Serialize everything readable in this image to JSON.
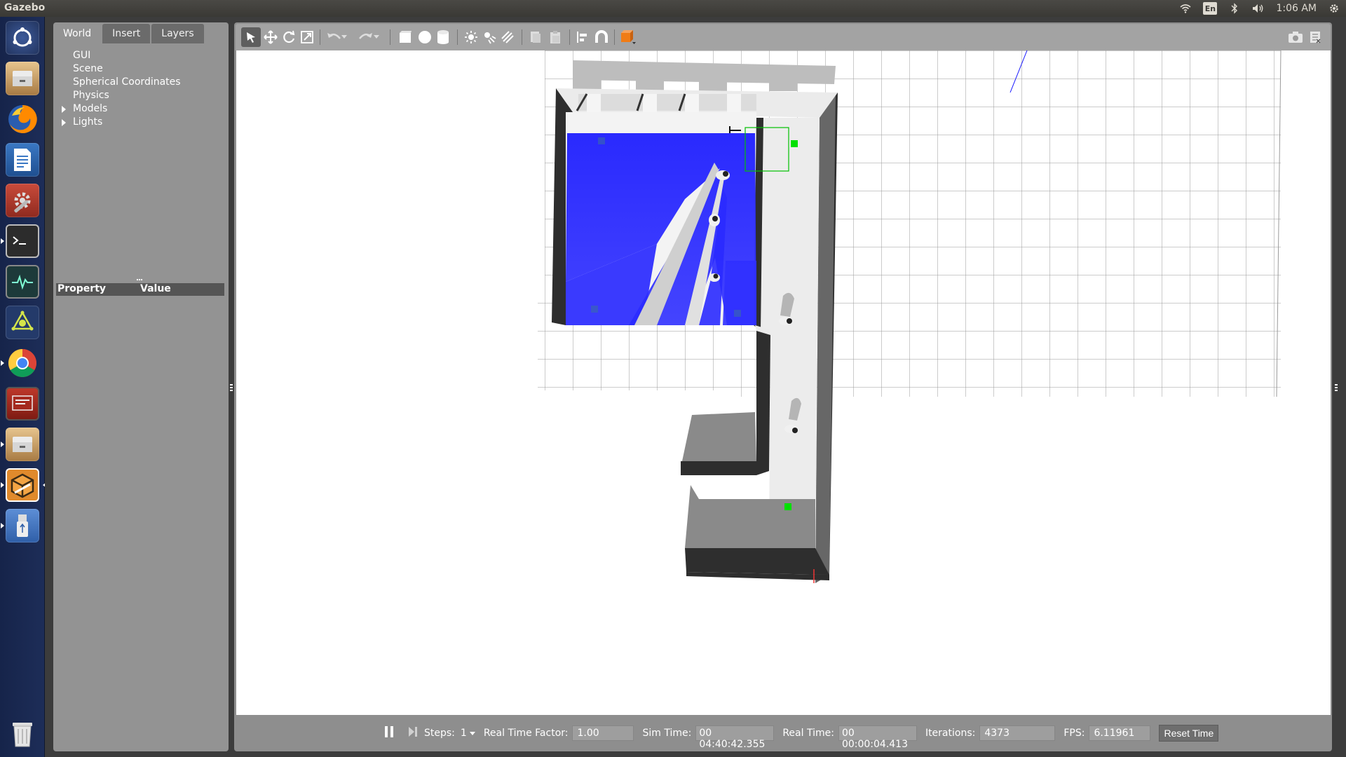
{
  "app": {
    "title": "Gazebo"
  },
  "tray": {
    "keyboard_layout": "En",
    "clock": "1:06 AM",
    "icons": [
      "wifi-icon",
      "keyboard-icon",
      "bluetooth-icon",
      "volume-icon",
      "system-settings-icon"
    ]
  },
  "launcher": {
    "items": [
      {
        "name": "ubuntu-dash-icon"
      },
      {
        "name": "files-icon"
      },
      {
        "name": "firefox-icon"
      },
      {
        "name": "libreoffice-writer-icon"
      },
      {
        "name": "system-settings-icon"
      },
      {
        "name": "terminal-icon"
      },
      {
        "name": "system-monitor-icon"
      },
      {
        "name": "rviz-icon"
      },
      {
        "name": "chrome-icon"
      },
      {
        "name": "presentation-icon"
      },
      {
        "name": "files-icon-2"
      },
      {
        "name": "gazebo-icon"
      },
      {
        "name": "usb-drive-icon"
      },
      {
        "name": "trash-icon"
      }
    ]
  },
  "left_panel": {
    "tabs": [
      {
        "label": "World",
        "active": true
      },
      {
        "label": "Insert",
        "active": false
      },
      {
        "label": "Layers",
        "active": false
      }
    ],
    "tree": [
      {
        "label": "GUI",
        "expandable": false
      },
      {
        "label": "Scene",
        "expandable": false
      },
      {
        "label": "Spherical Coordinates",
        "expandable": false
      },
      {
        "label": "Physics",
        "expandable": false
      },
      {
        "label": "Models",
        "expandable": true
      },
      {
        "label": "Lights",
        "expandable": true
      }
    ],
    "property_header": {
      "property": "Property",
      "value": "Value"
    }
  },
  "toolbar": {
    "tools": [
      "select-mode-icon",
      "translate-mode-icon",
      "rotate-mode-icon",
      "scale-mode-icon",
      "undo-icon",
      "redo-icon",
      "box-shape-icon",
      "sphere-shape-icon",
      "cylinder-shape-icon",
      "point-light-icon",
      "spot-light-icon",
      "directional-light-icon",
      "copy-icon",
      "paste-icon",
      "align-icon",
      "snap-icon",
      "change-view-icon",
      "screenshot-icon",
      "log-icon"
    ]
  },
  "bottom_bar": {
    "steps_label": "Steps:",
    "steps_value": "1",
    "rtf_label": "Real Time Factor:",
    "rtf_value": "1.00",
    "sim_time_label": "Sim Time:",
    "sim_time_value": "00 04:40:42.355",
    "real_time_label": "Real Time:",
    "real_time_value": "00 00:00:04.413",
    "iterations_label": "Iterations:",
    "iterations_value": "4373",
    "fps_label": "FPS:",
    "fps_value": "6.11961",
    "reset_label": "Reset Time"
  },
  "colors": {
    "laser_scan": "#2a2aff",
    "grid_line": "#9a9a9a",
    "wall_top": "#ebebeb",
    "wall_side": "#2e2e2e",
    "marker_green": "#00e000"
  }
}
